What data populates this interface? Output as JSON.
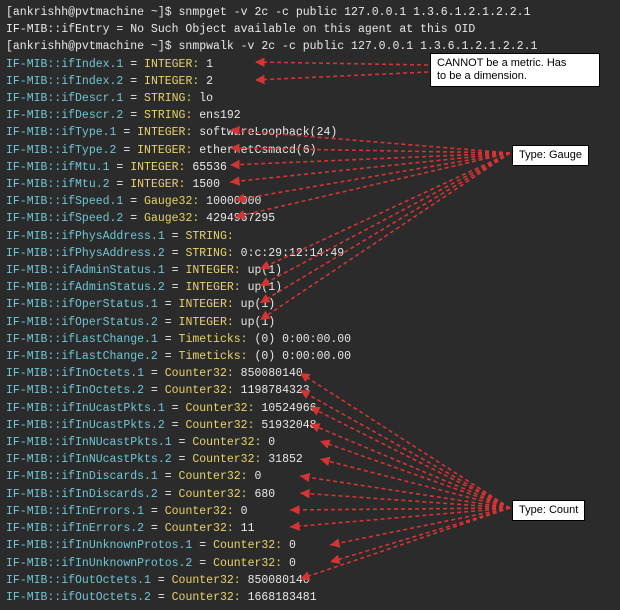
{
  "prompt1": {
    "host": "[ankrishh@pvtmachine ~]$ ",
    "cmd": "snmpget -v 2c -c public 127.0.0.1 1.3.6.1.2.1.2.2.1"
  },
  "resp1": "IF-MIB::ifEntry = No Such Object available on this agent at this OID",
  "prompt2": {
    "host": "[ankrishh@pvtmachine ~]$ ",
    "cmd": "snmpwalk -v 2c -c public 127.0.0.1 1.3.6.1.2.1.2.2.1"
  },
  "rows": [
    {
      "k": "IF-MIB::ifIndex.1",
      "t": "INTEGER",
      "v": "1"
    },
    {
      "k": "IF-MIB::ifIndex.2",
      "t": "INTEGER",
      "v": "2"
    },
    {
      "k": "IF-MIB::ifDescr.1",
      "t": "STRING",
      "v": "lo"
    },
    {
      "k": "IF-MIB::ifDescr.2",
      "t": "STRING",
      "v": "ens192"
    },
    {
      "k": "IF-MIB::ifType.1",
      "t": "INTEGER",
      "v": "softwareLoopback(24)"
    },
    {
      "k": "IF-MIB::ifType.2",
      "t": "INTEGER",
      "v": "ethernetCsmacd(6)"
    },
    {
      "k": "IF-MIB::ifMtu.1",
      "t": "INTEGER",
      "v": "65536"
    },
    {
      "k": "IF-MIB::ifMtu.2",
      "t": "INTEGER",
      "v": "1500"
    },
    {
      "k": "IF-MIB::ifSpeed.1",
      "t": "Gauge32",
      "v": "10000000"
    },
    {
      "k": "IF-MIB::ifSpeed.2",
      "t": "Gauge32",
      "v": "4294967295"
    },
    {
      "k": "IF-MIB::ifPhysAddress.1",
      "t": "STRING",
      "v": ""
    },
    {
      "k": "IF-MIB::ifPhysAddress.2",
      "t": "STRING",
      "v": "0:c:29:12:14:49"
    },
    {
      "k": "IF-MIB::ifAdminStatus.1",
      "t": "INTEGER",
      "v": "up(1)"
    },
    {
      "k": "IF-MIB::ifAdminStatus.2",
      "t": "INTEGER",
      "v": "up(1)"
    },
    {
      "k": "IF-MIB::ifOperStatus.1",
      "t": "INTEGER",
      "v": "up(1)"
    },
    {
      "k": "IF-MIB::ifOperStatus.2",
      "t": "INTEGER",
      "v": "up(1)"
    },
    {
      "k": "IF-MIB::ifLastChange.1",
      "t": "Timeticks",
      "v": "(0) 0:00:00.00"
    },
    {
      "k": "IF-MIB::ifLastChange.2",
      "t": "Timeticks",
      "v": "(0) 0:00:00.00"
    },
    {
      "k": "IF-MIB::ifInOctets.1",
      "t": "Counter32",
      "v": "850080140"
    },
    {
      "k": "IF-MIB::ifInOctets.2",
      "t": "Counter32",
      "v": "1198784323"
    },
    {
      "k": "IF-MIB::ifInUcastPkts.1",
      "t": "Counter32",
      "v": "10524966"
    },
    {
      "k": "IF-MIB::ifInUcastPkts.2",
      "t": "Counter32",
      "v": "51932048"
    },
    {
      "k": "IF-MIB::ifInNUcastPkts.1",
      "t": "Counter32",
      "v": "0"
    },
    {
      "k": "IF-MIB::ifInNUcastPkts.2",
      "t": "Counter32",
      "v": "31852"
    },
    {
      "k": "IF-MIB::ifInDiscards.1",
      "t": "Counter32",
      "v": "0"
    },
    {
      "k": "IF-MIB::ifInDiscards.2",
      "t": "Counter32",
      "v": "680"
    },
    {
      "k": "IF-MIB::ifInErrors.1",
      "t": "Counter32",
      "v": "0"
    },
    {
      "k": "IF-MIB::ifInErrors.2",
      "t": "Counter32",
      "v": "11"
    },
    {
      "k": "IF-MIB::ifInUnknownProtos.1",
      "t": "Counter32",
      "v": "0"
    },
    {
      "k": "IF-MIB::ifInUnknownProtos.2",
      "t": "Counter32",
      "v": "0"
    },
    {
      "k": "IF-MIB::ifOutOctets.1",
      "t": "Counter32",
      "v": "850080140"
    },
    {
      "k": "IF-MIB::ifOutOctets.2",
      "t": "Counter32",
      "v": "1668183481"
    }
  ],
  "ann_dimension": "CANNOT be a metric. Has\nto be a dimension.",
  "ann_gauge": "Type: Gauge",
  "ann_count": "Type: Count"
}
